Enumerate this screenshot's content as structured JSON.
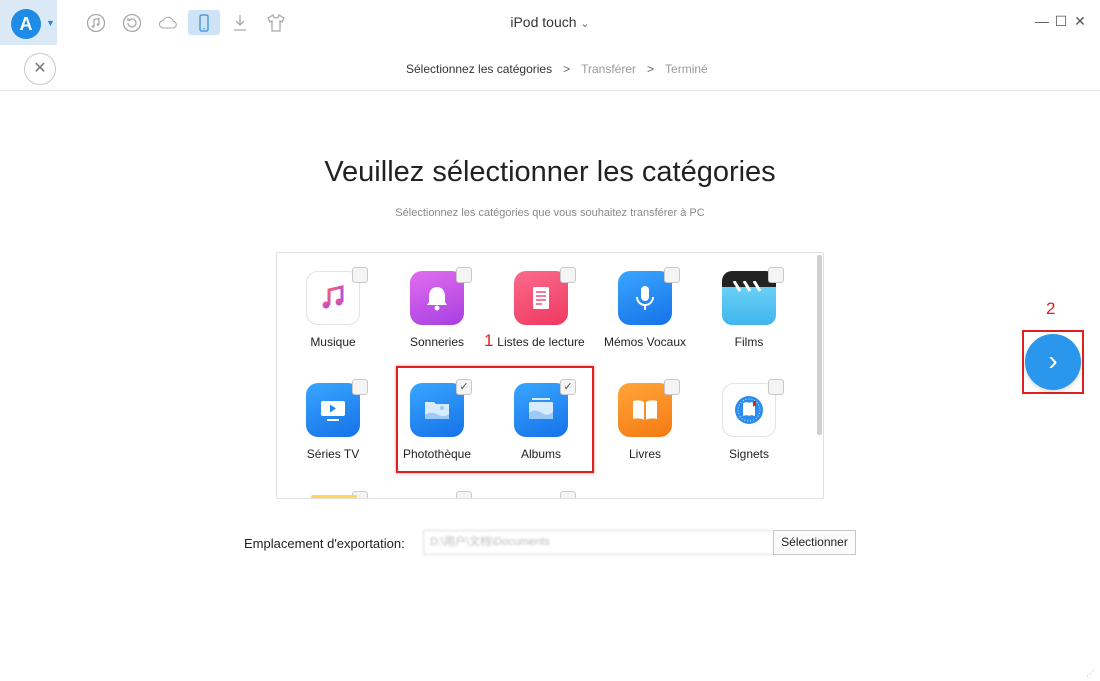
{
  "topbar": {
    "logo_letter": "A",
    "device_title": "iPod touch",
    "device_caret": "⌄",
    "window_controls": {
      "minimize": "—",
      "maximize": "☐",
      "close": "✕"
    }
  },
  "steps": {
    "items": [
      {
        "label": "Sélectionnez les catégories"
      },
      {
        "label": "Transférer"
      },
      {
        "label": "Terminé"
      }
    ],
    "separator": ">"
  },
  "page": {
    "title": "Veuillez sélectionner les catégories",
    "subtitle": "Sélectionnez les catégories que vous souhaitez transférer à PC"
  },
  "categories": [
    {
      "label": "Musique",
      "icon": "music-icon",
      "checked": false
    },
    {
      "label": "Sonneries",
      "icon": "bell-icon",
      "checked": false
    },
    {
      "label": "Listes de lecture",
      "icon": "playlist-icon",
      "checked": false
    },
    {
      "label": "Mémos Vocaux",
      "icon": "microphone-icon",
      "checked": false
    },
    {
      "label": "Films",
      "icon": "clapper-icon",
      "checked": false
    },
    {
      "label": "Séries TV",
      "icon": "tv-icon",
      "checked": false
    },
    {
      "label": "Photothèque",
      "icon": "photo-library-icon",
      "checked": true
    },
    {
      "label": "Albums",
      "icon": "albums-icon",
      "checked": true
    },
    {
      "label": "Livres",
      "icon": "book-icon",
      "checked": false
    },
    {
      "label": "Signets",
      "icon": "safari-icon",
      "checked": false
    }
  ],
  "annotations": {
    "one": "1",
    "two": "2"
  },
  "export": {
    "label": "Emplacement d'exportation:",
    "path": "D:\\用户\\文档\\Documents",
    "button": "Sélectionner"
  },
  "next": {
    "symbol": "›"
  },
  "colors": {
    "accent": "#2b97ec",
    "annotation": "#e02020"
  }
}
